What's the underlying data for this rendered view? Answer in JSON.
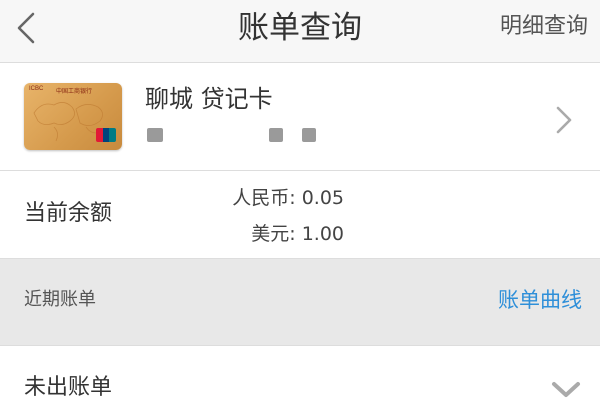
{
  "header": {
    "back_icon": "chevron-left-icon",
    "title": "账单查询",
    "detail_link": "明细查询"
  },
  "card": {
    "logo_text": "ICBC",
    "bank_name": "中国工商银行",
    "name": "聊城 贷记卡",
    "colors": {
      "card": "#d59a4c",
      "unionpay": [
        "#e21836",
        "#00447c",
        "#007b84"
      ]
    },
    "chevron_icon": "chevron-right-icon"
  },
  "balance": {
    "label": "当前余额",
    "rmb": "人民币: 0.05",
    "usd": "美元: 1.00"
  },
  "recent": {
    "title": "近期账单",
    "curve_link": "账单曲线",
    "link_color": "#2e8fd9"
  },
  "unbilled": {
    "label": "未出账单",
    "chevron_icon": "chevron-down-icon"
  }
}
